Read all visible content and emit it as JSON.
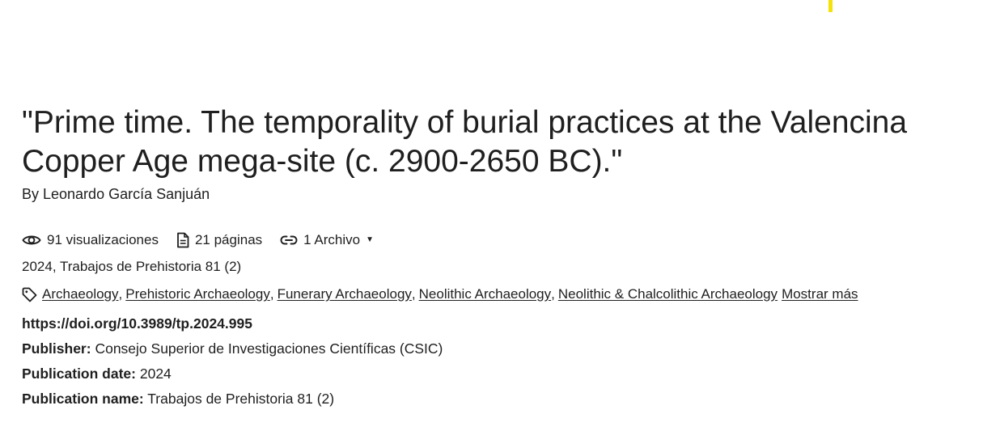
{
  "paper": {
    "title": "\"Prime time. The temporality of burial practices at the Valencina Copper Age mega-site (c. 2900-2650 BC).\"",
    "byline": "By Leonardo García Sanjuán"
  },
  "stats": {
    "views": "91 visualizaciones",
    "pages": "21 páginas",
    "files": "1 Archivo"
  },
  "citation": "2024, Trabajos de Prehistoria 81 (2)",
  "tags": {
    "items": [
      {
        "label": "Archaeology",
        "sep": ","
      },
      {
        "label": "Prehistoric Archaeology",
        "sep": ","
      },
      {
        "label": "Funerary Archaeology",
        "sep": ","
      },
      {
        "label": "Neolithic Archaeology",
        "sep": ","
      },
      {
        "label": "Neolithic & Chalcolithic Archaeology",
        "sep": ""
      }
    ],
    "more": "Mostrar más"
  },
  "meta": {
    "doi": "https://doi.org/10.3989/tp.2024.995",
    "publisher_label": "Publisher:",
    "publisher_value": "Consejo Superior de Investigaciones Científicas (CSIC)",
    "date_label": "Publication date:",
    "date_value": "2024",
    "name_label": "Publication name:",
    "name_value": "Trabajos de Prehistoria 81 (2)"
  },
  "colors": {
    "text": "#1f1f1f",
    "accent_mark": "#f5e20a"
  },
  "icons": {
    "views": "eye-icon",
    "pages": "document-icon",
    "files": "link-icon",
    "dropdown": "caret-down-icon",
    "tags": "tag-icon"
  }
}
